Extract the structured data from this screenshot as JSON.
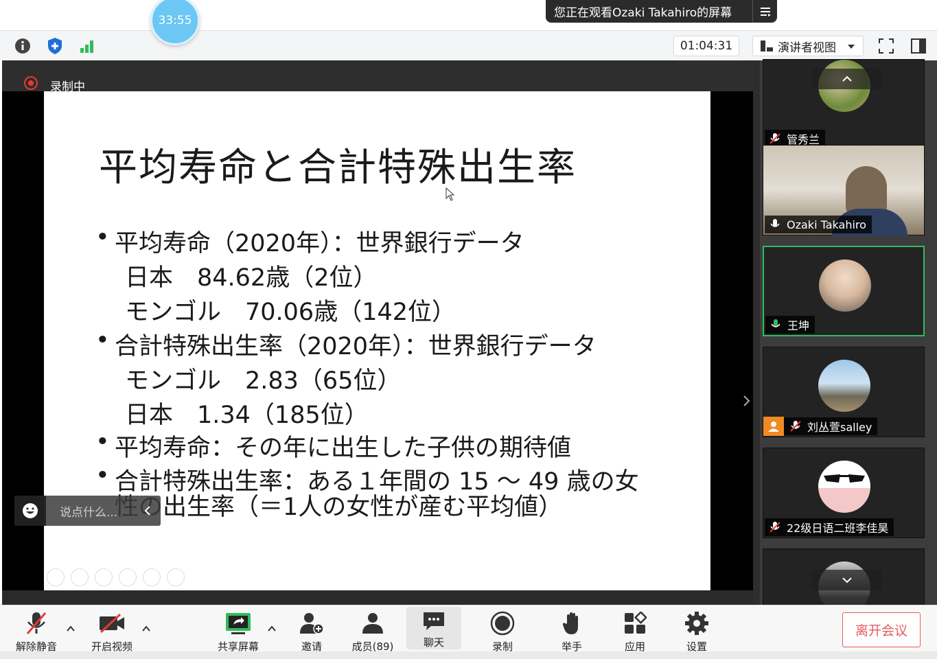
{
  "banner": {
    "text": "您正在观看Ozaki Takahiro的屏幕",
    "menu_icon": "list-menu-icon"
  },
  "timer_bubble": "33:55",
  "toolbar": {
    "meeting_time": "01:04:31",
    "view_mode": "演讲者视图",
    "icons": [
      "info-icon",
      "shield-icon",
      "signal-icon",
      "fullscreen-icon",
      "sidebar-toggle-icon"
    ]
  },
  "recording": {
    "label": "录制中"
  },
  "slide": {
    "title": "平均寿命と合計特殊出生率",
    "lines": [
      "平均寿命（2020年）：世界銀行データ",
      "日本　84.62歳（2位）",
      "モンゴル　70.06歳（142位）",
      "合計特殊出生率（2020年）：世界銀行データ",
      "モンゴル　2.83（65位）",
      "日本　1.34（185位）",
      "平均寿命：その年に出生した子供の期待値",
      "合計特殊出生率：ある１年間の 15 ～ 49 歳の女",
      "性の出生率（＝1人の女性が産む平均値）"
    ]
  },
  "chat_float": {
    "placeholder": "说点什么..."
  },
  "participants": [
    {
      "name": "管秀兰",
      "muted": true
    },
    {
      "name": "Ozaki Takahiro",
      "muted": false
    },
    {
      "name": "王坤",
      "muted": false,
      "speaking": true
    },
    {
      "name": "刘丛萱salley",
      "muted": true
    },
    {
      "name": "22级日语二班李佳昊",
      "muted": true
    },
    {
      "name": "",
      "muted": true
    }
  ],
  "bottom_bar": {
    "mute": "解除静音",
    "video": "开启视频",
    "share": "共享屏幕",
    "invite": "邀请",
    "members": "成员(89)",
    "chat": "聊天",
    "record": "录制",
    "raise_hand": "举手",
    "apps": "应用",
    "settings": "设置",
    "leave": "离开会议"
  },
  "colors": {
    "accent": "#2fbd5b",
    "danger": "#e45c5c",
    "bubble": "#6cc7f5",
    "recording": "#e53935"
  }
}
